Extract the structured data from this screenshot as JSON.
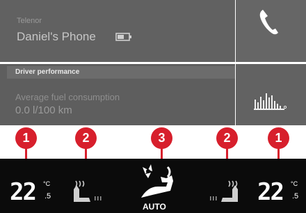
{
  "phone": {
    "network": "Telenor",
    "device": "Daniel's Phone"
  },
  "driver": {
    "section_title": "Driver performance",
    "metric_label": "Average fuel consumption",
    "metric_value": "0.0 l/100 km"
  },
  "climate": {
    "left": {
      "temp": "22",
      "unit": "°C",
      "decimal": ".5"
    },
    "right": {
      "temp": "22",
      "unit": "°C",
      "decimal": ".5"
    },
    "auto_label": "AUTO"
  },
  "callouts": [
    "1",
    "2",
    "3",
    "2",
    "1"
  ],
  "colors": {
    "callout": "#d71f2c",
    "climate_bar": "#0b0b0b",
    "panel": "#5f5f5f"
  },
  "icons": [
    "battery-icon",
    "phone-icon",
    "bar-chart-icon",
    "heated-seat-icon",
    "fan-auto-icon"
  ]
}
